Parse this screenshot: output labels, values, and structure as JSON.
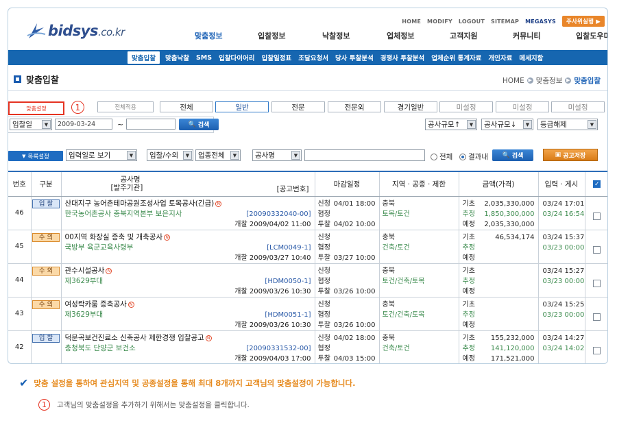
{
  "header": {
    "logo_text": "bidsys",
    "logo_tld": ".co.kr",
    "util_links": [
      "HOME",
      "MODIFY",
      "LOGOUT",
      "SITEMAP",
      "MEGASYS"
    ],
    "user_button": "주사위실행 ▶",
    "main_nav": [
      "맞춤정보",
      "입찰정보",
      "낙찰정보",
      "업체정보",
      "고객지원",
      "커뮤니티",
      "입찰도우미"
    ],
    "main_nav_active": 0,
    "sub_nav": [
      "맞춤입찰",
      "맞춤낙찰",
      "SMS",
      "입찰다이어리",
      "입찰일정표",
      "조달요청서",
      "당사 투찰분석",
      "경쟁사 투찰분석",
      "업체순위 통계자료",
      "개인자료",
      "메세지함"
    ],
    "sub_nav_active": 0
  },
  "page": {
    "title": "맞춤입찰",
    "breadcrumb": [
      "HOME",
      "맞춤정보",
      "맞춤입찰"
    ]
  },
  "tabs": {
    "custom_setting": "맞춤설정",
    "annotation_number": "1",
    "apply_all": "전체적용",
    "items": [
      "전체",
      "일반",
      "전문",
      "전문외",
      "경기일반",
      "미설정",
      "미설정",
      "미설정"
    ],
    "active_index": 1
  },
  "filter": {
    "date_type": "입찰일",
    "date_from": "2009-03-24",
    "tilde": "~",
    "date_to": "",
    "search_button": "검색",
    "sort1": "공사규모↑",
    "sort2": "공사규모↓",
    "grade": "등급해제"
  },
  "search": {
    "list_setting": "목록설정",
    "view_mode": "입력일로 보기",
    "bid_type": "입찰/수의",
    "industry": "업종전체",
    "field": "공사명",
    "query": "",
    "radio_all": "전체",
    "radio_within": "결과내",
    "radio_selected": "within",
    "search_button": "검색",
    "save_button": "공고저장"
  },
  "table": {
    "headers": {
      "no": "번호",
      "type": "구분",
      "title_line1": "공사명",
      "title_line2": "[발주기관]",
      "code": "[공고번호]",
      "schedule": "마감일정",
      "region": "지역 · 공종 · 제한",
      "amount": "금액(가격)",
      "registered": "입력 · 게시"
    },
    "rows": [
      {
        "no": "46",
        "type": "입 찰",
        "type_color": "blue",
        "name": "산대지구 농어촌테마공원조성사업 토목공사(긴급)",
        "agency": "한국농어촌공사 충북지역본부 보은지사",
        "code": "[20090332040-00]",
        "open": "개찰  2009/04/02 11:00",
        "apply": "신청",
        "apply_date": "04/01 18:00",
        "consult": "협정",
        "consult_date": "",
        "bid": "투찰",
        "bid_date": "04/02 10:00",
        "region": "충북",
        "category": "토목/토건",
        "base_label": "기초",
        "base": "2,035,330,000",
        "est_label": "추정",
        "est": "1,850,300,000",
        "plan_label": "예정",
        "plan": "2,035,330,000",
        "input_date": "03/24 17:01",
        "post_date": "03/24 16:54"
      },
      {
        "no": "45",
        "type": "수 의",
        "type_color": "orange",
        "name": "00지역 화장실 증축 및 개축공사",
        "agency": "국방부 육군교육사령부",
        "code": "[LCM0049-1]",
        "open": "개찰  2009/03/27 10:40",
        "apply": "신청",
        "apply_date": "",
        "consult": "협정",
        "consult_date": "",
        "bid": "투찰",
        "bid_date": "03/27 10:00",
        "region": "충북",
        "category": "건축/토건",
        "base_label": "기초",
        "base": "46,534,174",
        "est_label": "추정",
        "est": "",
        "plan_label": "예정",
        "plan": "",
        "input_date": "03/24 15:37",
        "post_date": "03/23 00:00"
      },
      {
        "no": "44",
        "type": "수 의",
        "type_color": "orange",
        "name": "관수시설공사",
        "agency": "제3629부대",
        "code": "[HDM0050-1]",
        "open": "개찰  2009/03/26 10:30",
        "apply": "신청",
        "apply_date": "",
        "consult": "협정",
        "consult_date": "",
        "bid": "투찰",
        "bid_date": "03/26 10:00",
        "region": "충북",
        "category": "토건/건축/토목",
        "base_label": "기초",
        "base": "",
        "est_label": "추정",
        "est": "",
        "plan_label": "예정",
        "plan": "",
        "input_date": "03/24 15:27",
        "post_date": "03/23 00:00"
      },
      {
        "no": "43",
        "type": "수 의",
        "type_color": "orange",
        "name": "여성락카룸 증축공사",
        "agency": "제3629부대",
        "code": "[HDM0051-1]",
        "open": "개찰  2009/03/26 10:30",
        "apply": "신청",
        "apply_date": "",
        "consult": "협정",
        "consult_date": "",
        "bid": "투찰",
        "bid_date": "03/26 10:00",
        "region": "충북",
        "category": "토건/건축/토목",
        "base_label": "기초",
        "base": "",
        "est_label": "추정",
        "est": "",
        "plan_label": "예정",
        "plan": "",
        "input_date": "03/24 15:25",
        "post_date": "03/23 00:00"
      },
      {
        "no": "42",
        "type": "입 찰",
        "type_color": "blue",
        "name": "덕문곡보건진료소 신축공사 제한경쟁 입찰공고",
        "agency": "충청북도 단양군 보건소",
        "code": "[20090331532-00]",
        "open": "개찰  2009/04/03 17:00",
        "apply": "신청",
        "apply_date": "04/02 18:00",
        "consult": "협정",
        "consult_date": "",
        "bid": "투찰",
        "bid_date": "04/03 15:00",
        "region": "충북",
        "category": "건축/토건",
        "base_label": "기초",
        "base": "155,232,000",
        "est_label": "추정",
        "est": "141,120,000",
        "plan_label": "예정",
        "plan": "171,521,000",
        "input_date": "03/24 14:27",
        "post_date": "03/24 14:02"
      }
    ]
  },
  "notes": {
    "main": "맞춤 설정을 통하여 관심지역 및 공종설정을 통해 최대 8개까지 고객님의 맞춤설정이 가능합니다.",
    "number": "1",
    "detail": "고객님의 맞춤설정을 추가하기 위해서는 맞춤설정을 클릭합니다."
  },
  "colors": {
    "brand_blue": "#1666b0",
    "accent_orange": "#e68a1e",
    "highlight_red": "#e53220",
    "agency_green": "#3a8a4c"
  }
}
